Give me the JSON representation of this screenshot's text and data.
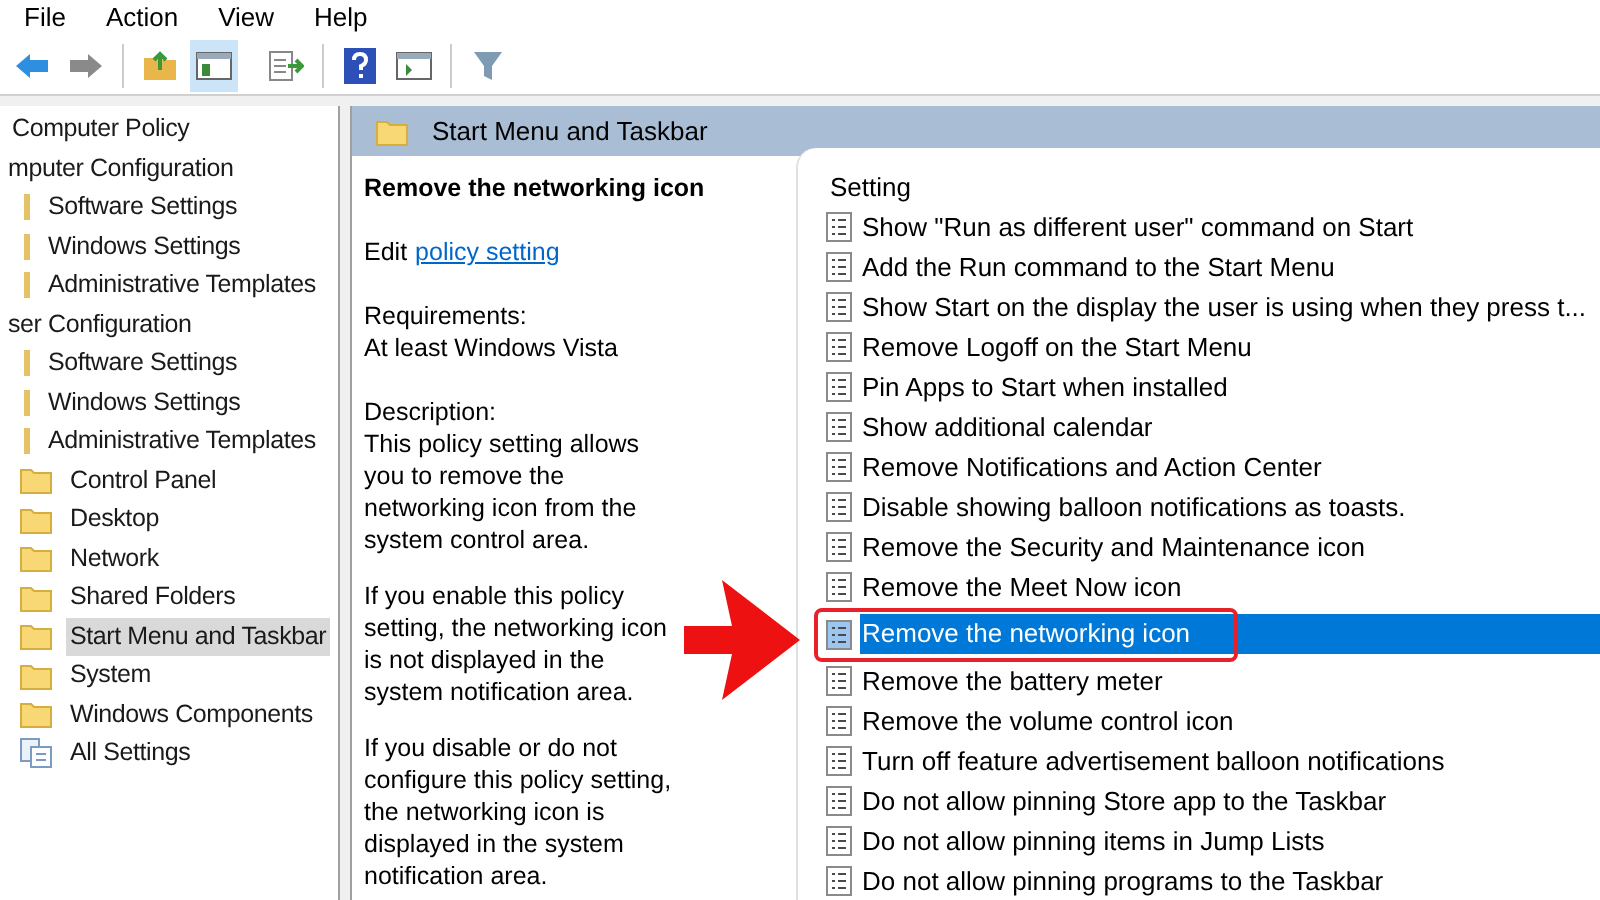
{
  "menu": [
    "File",
    "Action",
    "View",
    "Help"
  ],
  "tree": [
    {
      "label": "Computer Policy",
      "selected": false,
      "children": [
        {
          "label": "mputer Configuration",
          "selected": false,
          "children": [
            {
              "label": "Software Settings",
              "selected": false
            },
            {
              "label": "Windows Settings",
              "selected": false
            },
            {
              "label": "Administrative Templates",
              "selected": false
            }
          ]
        },
        {
          "label": "ser Configuration",
          "selected": false,
          "children": [
            {
              "label": "Software Settings",
              "selected": false
            },
            {
              "label": "Windows Settings",
              "selected": false
            },
            {
              "label": "Administrative Templates",
              "selected": false,
              "children": [
                {
                  "label": "Control Panel",
                  "kind": "folder",
                  "selected": false
                },
                {
                  "label": "Desktop",
                  "kind": "folder",
                  "selected": false
                },
                {
                  "label": "Network",
                  "kind": "folder",
                  "selected": false
                },
                {
                  "label": "Shared Folders",
                  "kind": "folder",
                  "selected": false
                },
                {
                  "label": "Start Menu and Taskbar",
                  "kind": "folder",
                  "selected": true
                },
                {
                  "label": "System",
                  "kind": "folder",
                  "selected": false
                },
                {
                  "label": "Windows Components",
                  "kind": "folder",
                  "selected": false
                },
                {
                  "label": "All Settings",
                  "kind": "settings",
                  "selected": false
                }
              ]
            }
          ]
        }
      ]
    }
  ],
  "header": "Start Menu and Taskbar",
  "detail": {
    "title": "Remove the networking icon",
    "edit_prefix": "Edit",
    "edit_link": "policy setting",
    "requirements_label": "Requirements:",
    "requirements": "At least Windows Vista",
    "description_label": "Description:",
    "paragraphs": [
      "This policy setting allows you to remove the networking icon from the system control area.",
      "If you enable this policy setting, the networking icon is not displayed in the system notification area.",
      "If you disable or do not configure this policy setting, the networking icon is displayed in the system notification area."
    ]
  },
  "list": {
    "column": "Setting",
    "rows": [
      {
        "label": "Show \"Run as different user\" command on Start",
        "selected": false
      },
      {
        "label": "Add the Run command to the Start Menu",
        "selected": false
      },
      {
        "label": "Show Start on the display the user is using when they press t...",
        "selected": false
      },
      {
        "label": "Remove Logoff on the Start Menu",
        "selected": false
      },
      {
        "label": "Pin Apps to Start when installed",
        "selected": false
      },
      {
        "label": "Show additional calendar",
        "selected": false
      },
      {
        "label": "Remove Notifications and Action Center",
        "selected": false
      },
      {
        "label": "Disable showing balloon notifications as toasts.",
        "selected": false
      },
      {
        "label": "Remove the Security and Maintenance icon",
        "selected": false
      },
      {
        "label": "Remove the Meet Now icon",
        "selected": false
      },
      {
        "label": "Remove the networking icon",
        "selected": true
      },
      {
        "label": "Remove the battery meter",
        "selected": false
      },
      {
        "label": "Remove the volume control icon",
        "selected": false
      },
      {
        "label": "Turn off feature advertisement balloon notifications",
        "selected": false
      },
      {
        "label": "Do not allow pinning Store app to the Taskbar",
        "selected": false
      },
      {
        "label": "Do not allow pinning items in Jump Lists",
        "selected": false
      },
      {
        "label": "Do not allow pinning programs to the Taskbar",
        "selected": false
      }
    ]
  }
}
